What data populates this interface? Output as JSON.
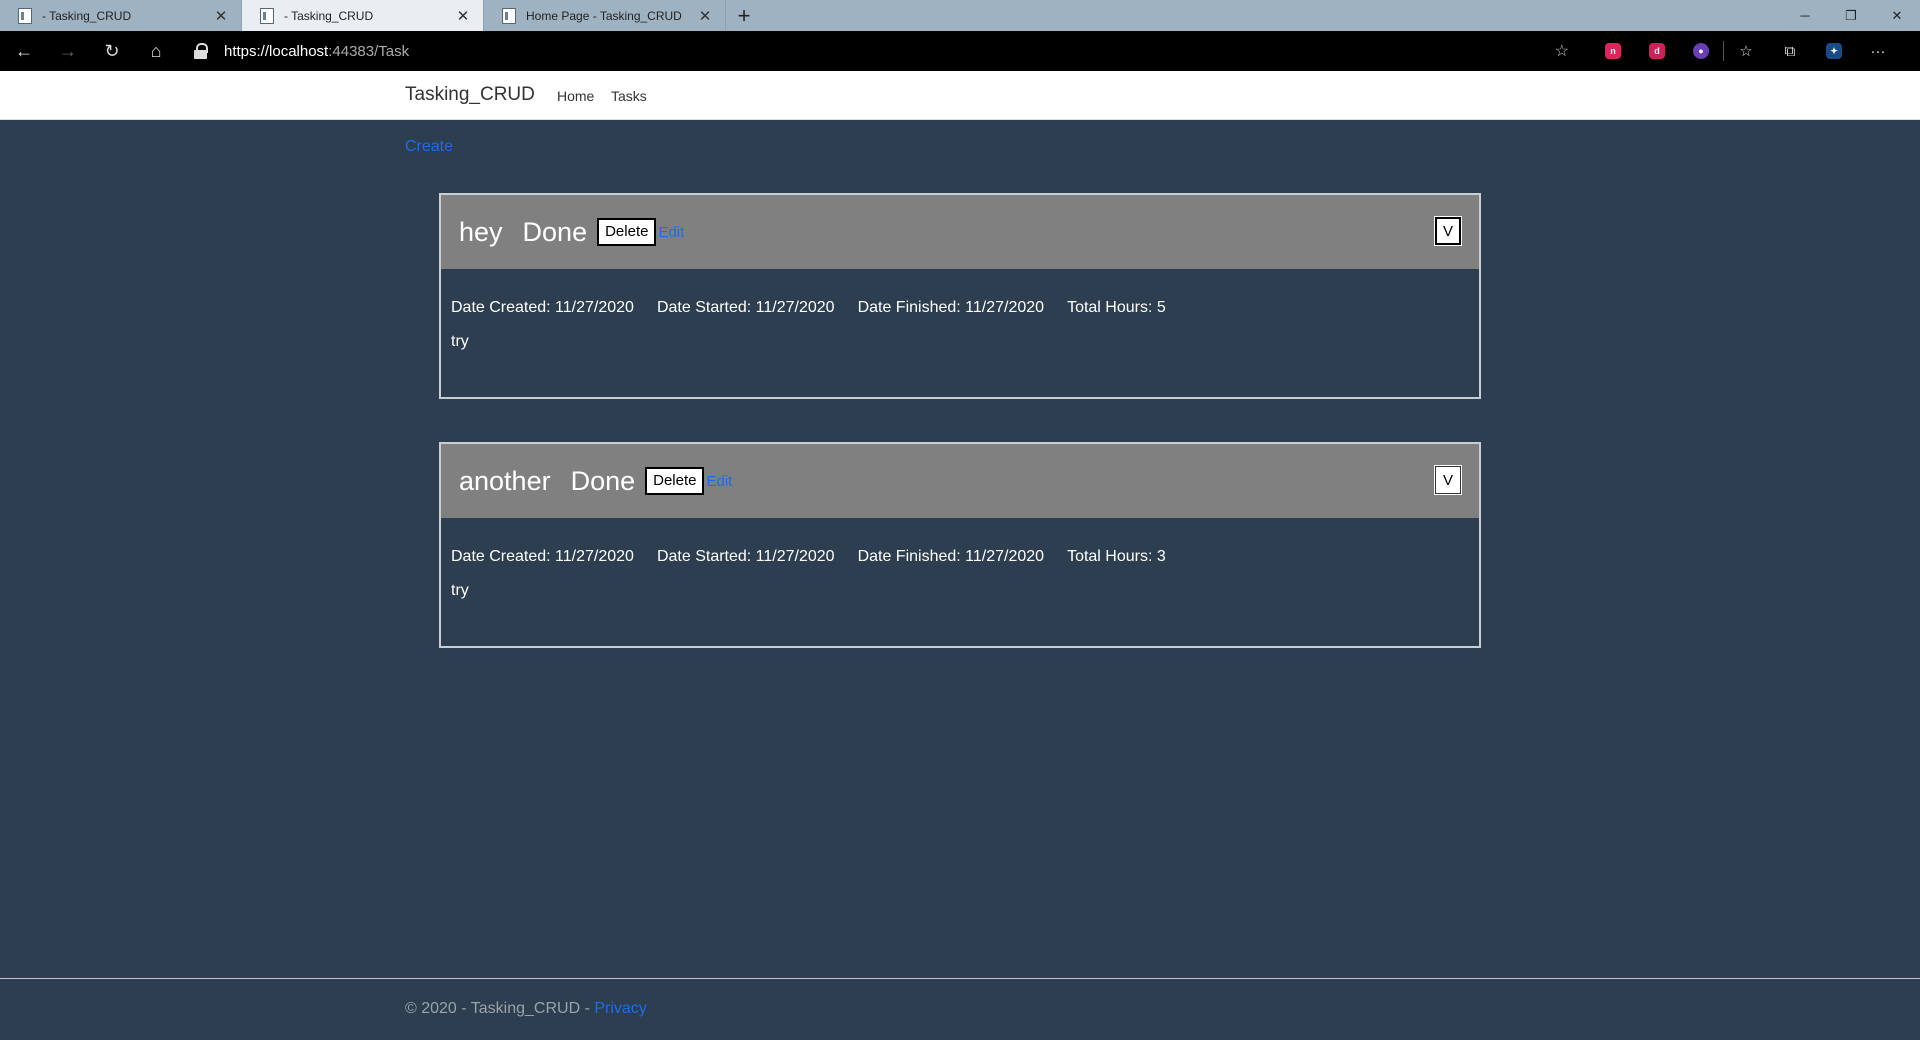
{
  "browser": {
    "tabs": [
      {
        "title": "- Tasking_CRUD",
        "active": false
      },
      {
        "title": "- Tasking_CRUD",
        "active": true
      },
      {
        "title": "Home Page - Tasking_CRUD",
        "active": false
      }
    ],
    "url": {
      "scheme_host": "https://localhost",
      "rest": ":44383/Task"
    }
  },
  "header": {
    "brand": "Tasking_CRUD",
    "nav": [
      "Home",
      "Tasks"
    ]
  },
  "main": {
    "create_label": "Create",
    "tasks": [
      {
        "title": "hey",
        "status": "Done",
        "delete_label": "Delete",
        "edit_label": "Edit",
        "toggle_label": "V",
        "date_created": "Date Created: 11/27/2020",
        "date_started": "Date Started: 11/27/2020",
        "date_finished": "Date Finished: 11/27/2020",
        "total_hours": "Total Hours: 5",
        "description": "try"
      },
      {
        "title": "another",
        "status": "Done",
        "delete_label": "Delete",
        "edit_label": "Edit",
        "toggle_label": "V",
        "date_created": "Date Created: 11/27/2020",
        "date_started": "Date Started: 11/27/2020",
        "date_finished": "Date Finished: 11/27/2020",
        "total_hours": "Total Hours: 3",
        "description": "try"
      }
    ]
  },
  "footer": {
    "text": "© 2020 - Tasking_CRUD - ",
    "privacy_label": "Privacy"
  },
  "colors": {
    "page_bg": "#2c3e50",
    "card_header_bg": "#808080",
    "link": "#1b6ee6"
  }
}
